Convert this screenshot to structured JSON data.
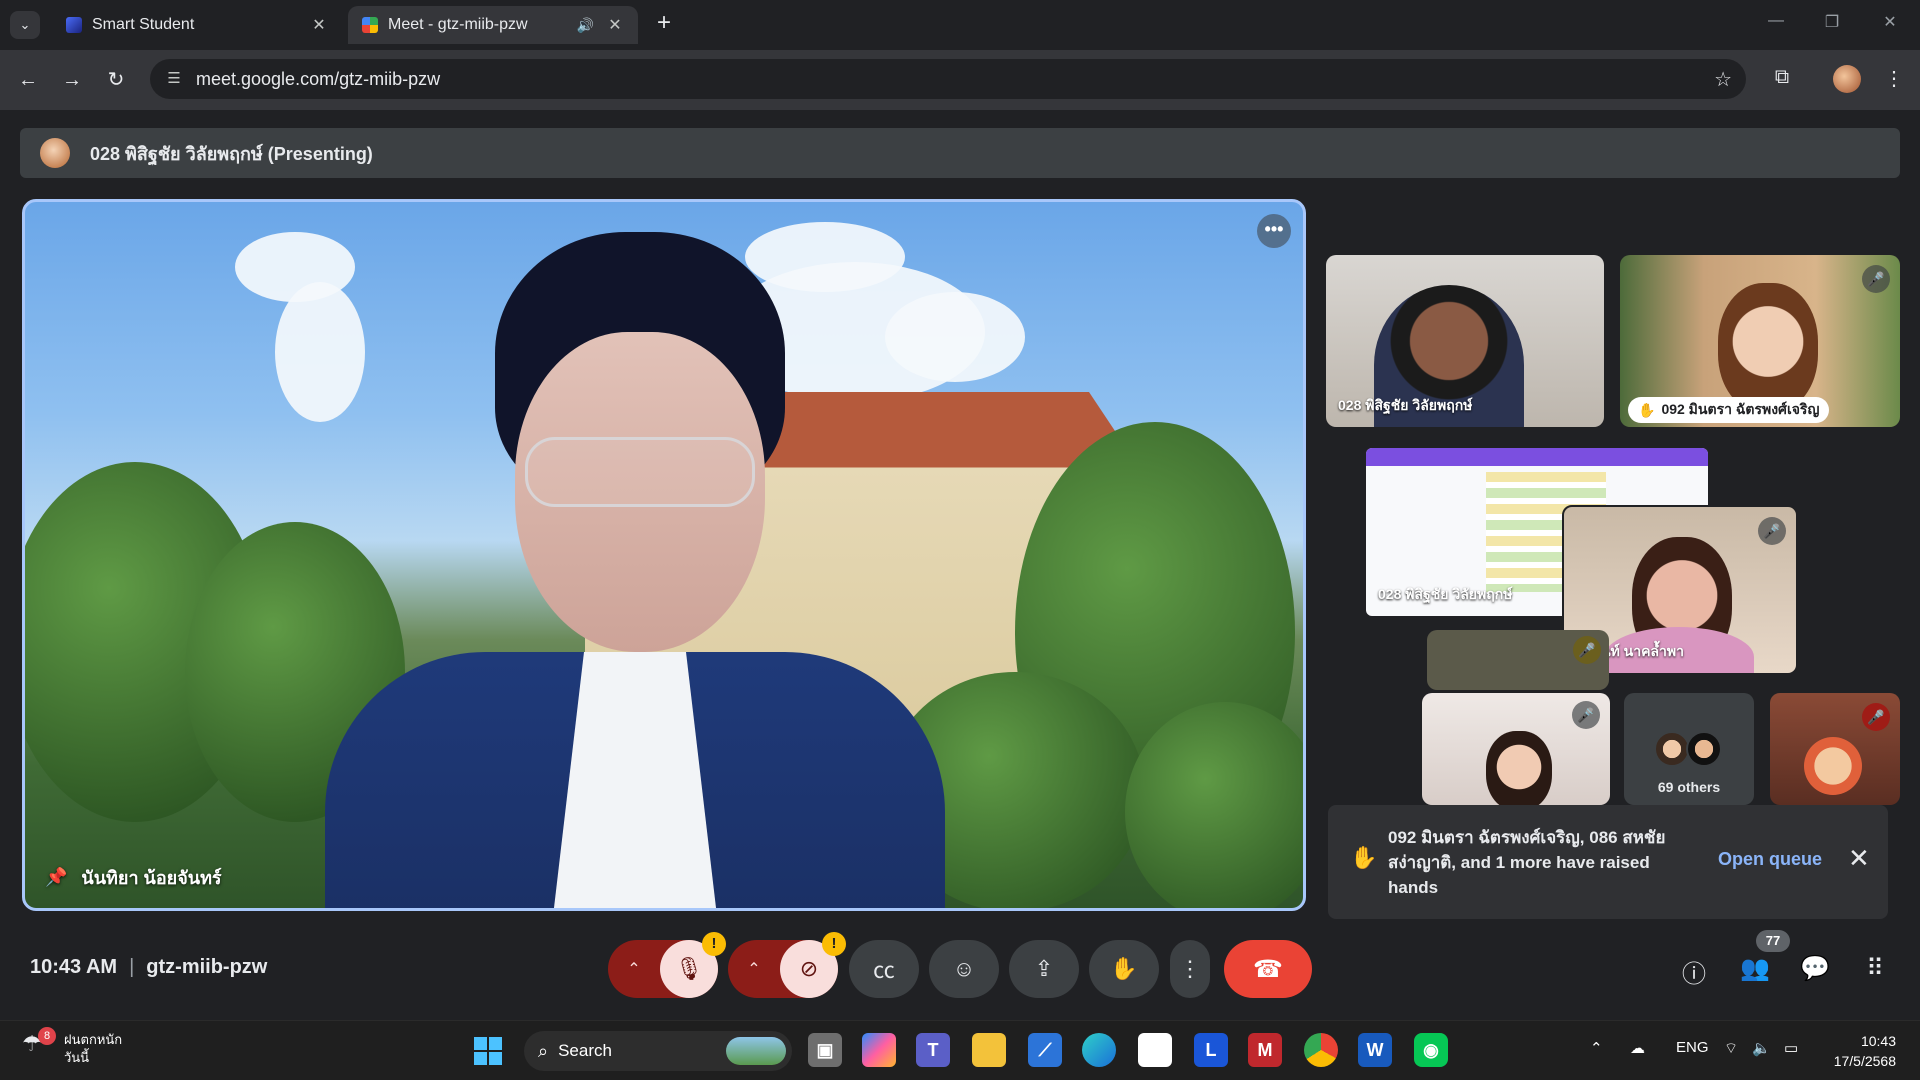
{
  "browser": {
    "tabs": [
      {
        "title": "Smart Student",
        "active": false
      },
      {
        "title": "Meet - gtz-miib-pzw",
        "active": true
      }
    ],
    "url": "meet.google.com/gtz-miib-pzw",
    "controls": {
      "tab_list": "chevron-down-icon",
      "new_tab": "+",
      "minimize": "—",
      "restore": "❐",
      "close": "✕"
    }
  },
  "meet": {
    "presenting_banner": "028 พิสิฐชัย วิลัยพฤกษ์ (Presenting)",
    "main_speaker": {
      "name": "นันทิยา น้อยจันทร์",
      "pinned": true
    },
    "participants": [
      {
        "name": "028 พิสิฐชัย วิลัยพฤกษ์",
        "muted": false,
        "hand_raised": false
      },
      {
        "name": "092 มินตรา ฉัตรพงศ์เจริญ",
        "muted": true,
        "hand_raised": true
      },
      {
        "name": "028 พิสิฐชัย วิลัยพฤกษ์",
        "muted": false,
        "hand_raised": false,
        "screen_share": true
      },
      {
        "name": "รุวนันท์ นาคล้ำพา",
        "muted": true,
        "hand_raised": false
      }
    ],
    "others_label": "69 others",
    "raised_hands_toast": {
      "message": "092 มินตรา ฉัตรพงศ์เจริญ, 086 สหชัย สง่าญาติ, and 1 more have raised hands",
      "action": "Open queue"
    },
    "footer": {
      "time": "10:43 AM",
      "meeting_code": "gtz-miib-pzw",
      "participant_count": "77",
      "mic_state": "muted",
      "camera_state": "off"
    }
  },
  "taskbar": {
    "weather_text_line1": "ฝนตกหนัก",
    "weather_text_line2": "วันนี้",
    "weather_badge": "8",
    "search_label": "Search",
    "language": "ENG",
    "clock_time": "10:43",
    "clock_date": "17/5/2568"
  },
  "colors": {
    "accent_blue": "#8ab4f8",
    "end_call_red": "#ea4335",
    "muted_red": "#8c1d18",
    "warning_yellow": "#fbbc04",
    "tile_border": "#a8c7fa"
  }
}
